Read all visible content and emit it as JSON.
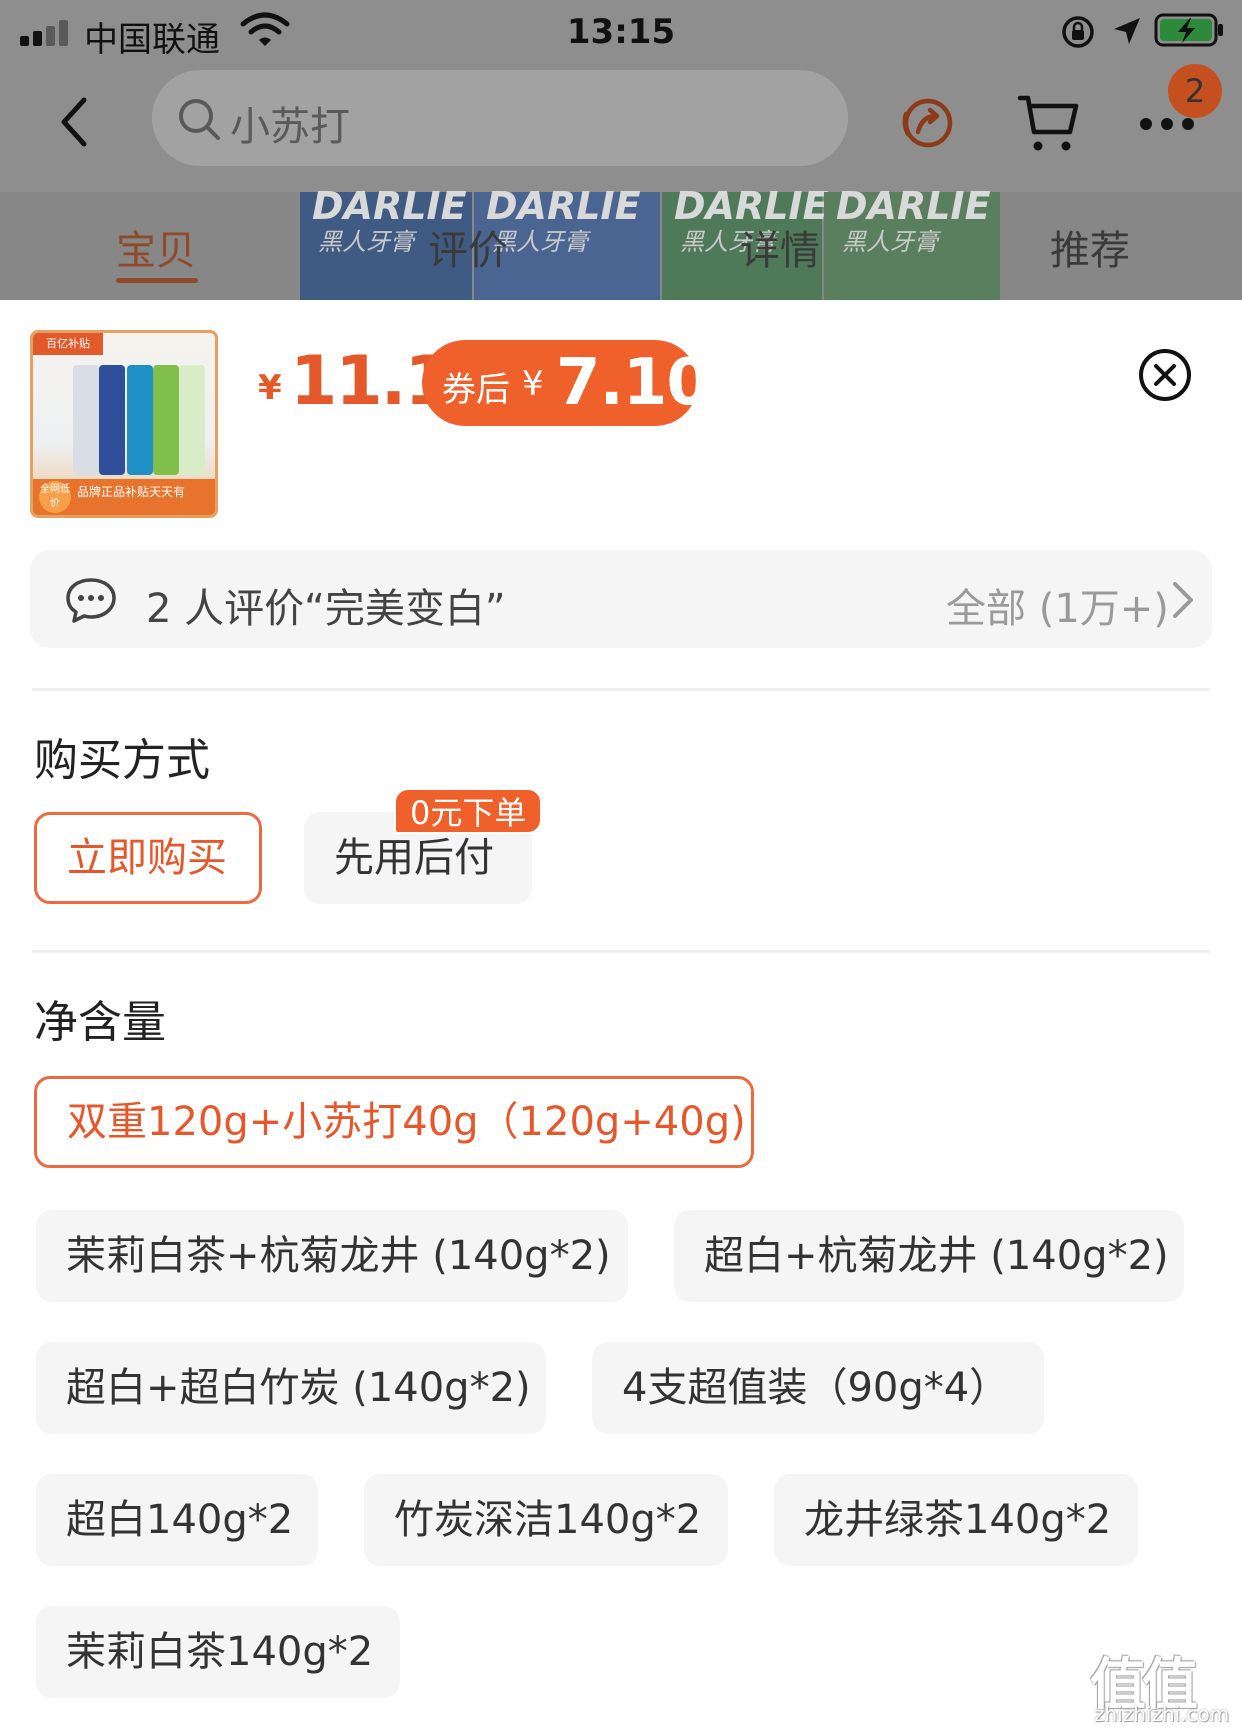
{
  "status_bar": {
    "carrier": "中国联通",
    "time": "13:15"
  },
  "nav": {
    "search_text": "小苏打",
    "cart_badge": "2"
  },
  "tabs": [
    {
      "label": "宝贝",
      "active": true
    },
    {
      "label": "评价",
      "active": false
    },
    {
      "label": "详情",
      "active": false
    },
    {
      "label": "推荐",
      "active": false
    }
  ],
  "product_strip": {
    "brand": "DARLIE",
    "brand_cn": "黑人牙膏"
  },
  "thumbnail": {
    "tag": "百亿补贴",
    "footer": "品牌正品补贴天天有",
    "circle": "全网低价"
  },
  "price": {
    "currency": "¥",
    "value": "11.1",
    "coupon_label": "券后",
    "coupon_currency": "¥",
    "coupon_value": "7.10"
  },
  "review": {
    "text": "2 人评价“完美变白”",
    "all": "全部 (1万+)"
  },
  "purchase_method": {
    "title": "购买方式",
    "options": [
      {
        "label": "立即购买",
        "selected": true
      },
      {
        "label": "先用后付",
        "selected": false
      }
    ],
    "promo_tag": "0元下单"
  },
  "net_content": {
    "title": "净含量",
    "options": [
      {
        "label": "双重120g+小苏打40g（120g+40g)",
        "selected": true
      },
      {
        "label": "茉莉白茶+杭菊龙井 (140g*2)",
        "selected": false
      },
      {
        "label": "超白+杭菊龙井 (140g*2)",
        "selected": false
      },
      {
        "label": "超白+超白竹炭 (140g*2)",
        "selected": false
      },
      {
        "label": "4支超值装（90g*4）",
        "selected": false
      },
      {
        "label": "超白140g*2",
        "selected": false
      },
      {
        "label": "竹炭深洁140g*2",
        "selected": false
      },
      {
        "label": "龙井绿茶140g*2",
        "selected": false
      },
      {
        "label": "茉莉白茶140g*2",
        "selected": false
      }
    ]
  },
  "watermark": {
    "main": "值值值",
    "sub": "zhizhizhi.com"
  },
  "colors": {
    "accent": "#f0602a",
    "price": "#e4582a",
    "option_bg": "#f5f5f5"
  }
}
